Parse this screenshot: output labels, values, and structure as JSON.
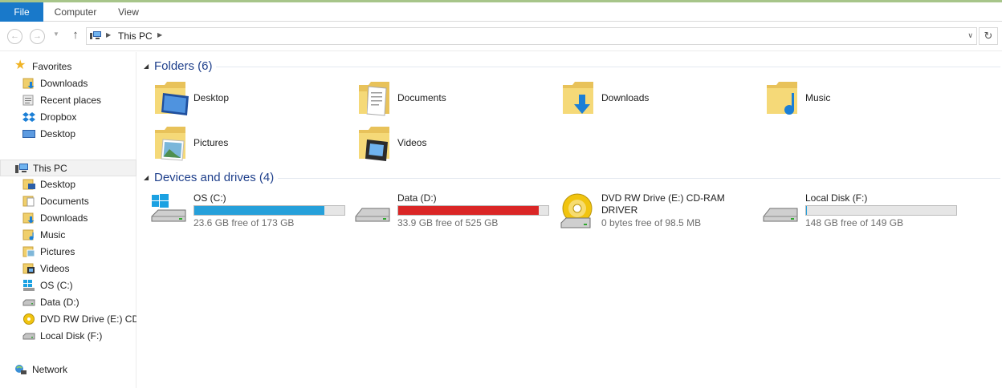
{
  "ribbon": {
    "tabs": [
      "File",
      "Computer",
      "View"
    ]
  },
  "address": {
    "path": "This PC"
  },
  "sidebar": {
    "favorites": {
      "label": "Favorites",
      "items": [
        "Downloads",
        "Recent places",
        "Dropbox",
        "Desktop"
      ]
    },
    "this_pc": {
      "label": "This PC",
      "items": [
        "Desktop",
        "Documents",
        "Downloads",
        "Music",
        "Pictures",
        "Videos",
        "OS (C:)",
        "Data (D:)",
        "DVD RW Drive (E:) CD-",
        "Local Disk (F:)"
      ]
    },
    "network": {
      "label": "Network"
    }
  },
  "content": {
    "folders": {
      "title": "Folders (6)",
      "items": [
        "Desktop",
        "Documents",
        "Downloads",
        "Music",
        "Pictures",
        "Videos"
      ]
    },
    "drives": {
      "title": "Devices and drives (4)",
      "items": [
        {
          "name": "OS (C:)",
          "free_text": "23.6 GB free of 173 GB",
          "used_fraction": 0.864,
          "bar_color": "#26a0da"
        },
        {
          "name": "Data (D:)",
          "free_text": "33.9 GB free of 525 GB",
          "used_fraction": 0.935,
          "bar_color": "#da2626"
        },
        {
          "name": "DVD RW Drive (E:) CD-RAM DRIVER",
          "free_text": "0 bytes free of 98.5 MB"
        },
        {
          "name": "Local Disk (F:)",
          "free_text": "148 GB free of 149 GB",
          "used_fraction": 0.007,
          "bar_color": "#26a0da"
        }
      ]
    }
  },
  "colors": {
    "accent": "#1979ca",
    "group_title": "#1e3f8b",
    "folder": "#f0cf6b"
  }
}
